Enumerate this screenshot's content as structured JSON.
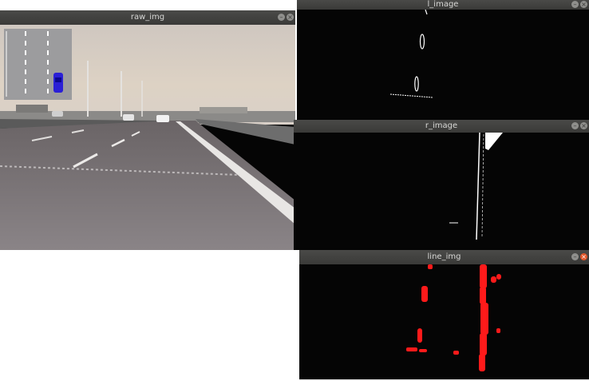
{
  "windows": {
    "raw": {
      "title": "raw_img",
      "minimize_glyph": "–",
      "close_glyph": "×"
    },
    "l": {
      "title": "l_image",
      "minimize_glyph": "–",
      "close_glyph": "×"
    },
    "r": {
      "title": "r_image",
      "minimize_glyph": "–",
      "close_glyph": "×"
    },
    "line": {
      "title": "line_img",
      "minimize_glyph": "–",
      "close_glyph": "×"
    }
  },
  "icons": [
    "minimize-icon",
    "close-icon"
  ],
  "colors": {
    "titlebar": "#3f3f3d",
    "detected_lines": "#ff1a1a",
    "vehicle_marker": "#2a1fd6"
  }
}
